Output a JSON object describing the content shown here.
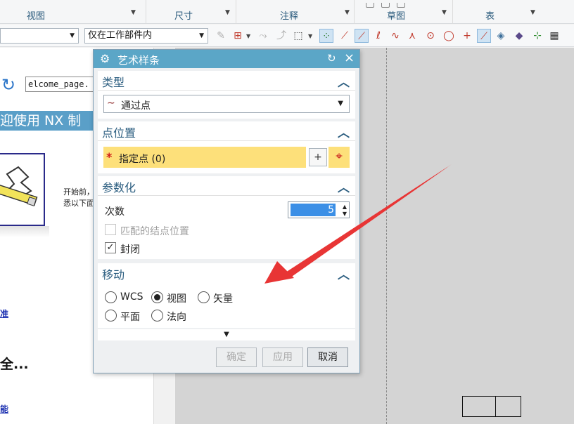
{
  "ribbon": {
    "groups": [
      {
        "label": "视图"
      },
      {
        "label": "尺寸"
      },
      {
        "label": "注释"
      },
      {
        "label": "草图"
      },
      {
        "label": "表"
      }
    ]
  },
  "toolbar": {
    "filter_value": "",
    "scope_value": "仅在工作部件内"
  },
  "webpane": {
    "url": "elcome_page.",
    "welcome_title": "迎使用 NX 制",
    "intro_line1": "开始前，",
    "intro_line2": "悉以下面",
    "link1": "准",
    "heading": "全...",
    "link2": "能"
  },
  "dialog": {
    "title": "艺术样条",
    "type_section": {
      "label": "类型",
      "value": "通过点"
    },
    "point_section": {
      "label": "点位置",
      "specify_point": "指定点 (0)"
    },
    "param_section": {
      "label": "参数化",
      "degree_label": "次数",
      "degree_value": "5",
      "match_knots_label": "匹配的结点位置",
      "closed_label": "封闭"
    },
    "move_section": {
      "label": "移动",
      "options": [
        "WCS",
        "视图",
        "矢量",
        "平面",
        "法向"
      ],
      "selected": "视图"
    },
    "buttons": {
      "ok": "确定",
      "apply": "应用",
      "cancel": "取消"
    }
  },
  "colors": {
    "titlebar": "#5ba6c7",
    "required_highlight": "#fde07a",
    "annotation_arrow": "#e83535"
  }
}
